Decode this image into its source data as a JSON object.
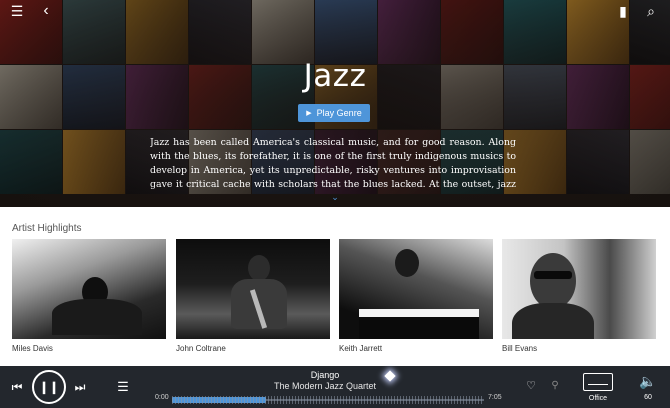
{
  "genre": {
    "title": "Jazz",
    "play_label": "Play Genre",
    "description": "Jazz has been called America's classical music, and for good reason. Along with the blues, its forefather, it is one of the first truly indigenous musics to develop in America, yet its unpredictable, risky ventures into improvisation gave it critical cache with scholars that the blues lacked. At the outset, jazz was dance music,"
  },
  "icons": {
    "menu": "☰",
    "back": "‹",
    "bookmark": "▮",
    "search": "⌕",
    "expand": "⌄",
    "play_triangle": "▶",
    "prev": "⏮",
    "pause": "❙❙",
    "next": "⏭",
    "queue": "☰",
    "heart": "♡",
    "share": "⚲",
    "volume": "🔈"
  },
  "artists_section": {
    "title": "Artist Highlights",
    "items": [
      {
        "name": "Miles Davis"
      },
      {
        "name": "John Coltrane"
      },
      {
        "name": "Keith Jarrett"
      },
      {
        "name": "Bill Evans"
      }
    ]
  },
  "player": {
    "track_title": "Django",
    "track_artist": "The Modern Jazz Quartet",
    "elapsed": "0:00",
    "duration": "7:05",
    "progress_fraction": 0.3,
    "room": "Office",
    "volume": "60"
  },
  "colors": {
    "accent": "#4e95d9",
    "player_bg": "#23272d"
  }
}
